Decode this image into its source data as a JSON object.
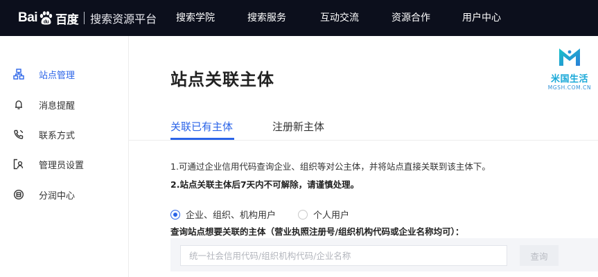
{
  "header": {
    "logo_text_left": "Bai",
    "logo_text_right": "百度",
    "platform_name": "搜索资源平台",
    "nav": [
      {
        "label": "搜索学院"
      },
      {
        "label": "搜索服务"
      },
      {
        "label": "互动交流"
      },
      {
        "label": "资源合作"
      },
      {
        "label": "用户中心"
      }
    ]
  },
  "sidebar": {
    "items": [
      {
        "label": "站点管理",
        "icon": "site-tree-icon",
        "active": true
      },
      {
        "label": "消息提醒",
        "icon": "bell-icon",
        "active": false
      },
      {
        "label": "联系方式",
        "icon": "phone-icon",
        "active": false
      },
      {
        "label": "管理员设置",
        "icon": "admin-icon",
        "active": false
      },
      {
        "label": "分润中心",
        "icon": "revenue-icon",
        "active": false
      }
    ]
  },
  "main": {
    "title": "站点关联主体",
    "tabs": [
      {
        "label": "关联已有主体",
        "active": true
      },
      {
        "label": "注册新主体",
        "active": false
      }
    ],
    "notices": [
      "1.可通过企业信用代码查询企业、组织等对公主体，并将站点直接关联到该主体下。",
      "2.站点关联主体后7天内不可解除，请谨慎处理。"
    ],
    "radios": [
      {
        "label": "企业、组织、机构用户",
        "checked": true
      },
      {
        "label": "个人用户",
        "checked": false
      }
    ],
    "query_label": "查询站点想要关联的主体（营业执照注册号/组织机构代码或企业名称均可）：",
    "query_input": {
      "value": "",
      "placeholder": "统一社会信用代码/组织机构代码/企业名称"
    },
    "query_button": "查询"
  },
  "watermark": {
    "name": "米国生活",
    "domain": "MGSH.COM.CN"
  },
  "colors": {
    "accent": "#2b64e8",
    "topbar": "#0c0f1c",
    "watermark": "#17a8d8"
  }
}
